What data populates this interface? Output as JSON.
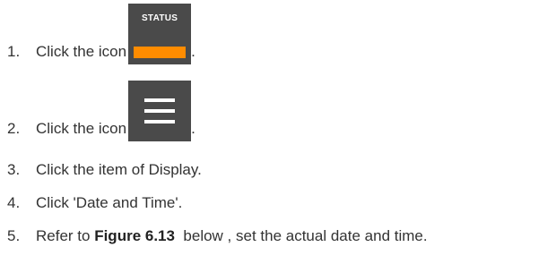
{
  "steps": [
    {
      "number": "1.",
      "text": "Click the icon",
      "suffix": ".",
      "icon": "status-icon",
      "icon_label": "STATUS"
    },
    {
      "number": "2.",
      "text": "Click the icon",
      "suffix": ".",
      "icon": "hamburger-menu-icon"
    },
    {
      "number": "3.",
      "text": "Click the item of Display."
    },
    {
      "number": "4.",
      "text": "Click 'Date and Time'."
    },
    {
      "number": "5.",
      "text_before": "Refer to ",
      "figure_ref": "Figure 6.13",
      "text_after": "  below , set the actual date and time."
    }
  ],
  "colors": {
    "icon_background": "#4a4a4a",
    "status_bar": "#ff8c00",
    "text": "#333333"
  }
}
